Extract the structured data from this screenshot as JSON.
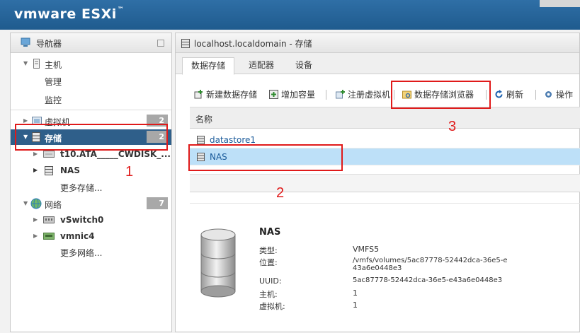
{
  "app": {
    "brand": "vmware",
    "product": "ESXi"
  },
  "navigator": {
    "title": "导航器",
    "items": [
      {
        "label": "主机",
        "level": 0,
        "expanded": true
      },
      {
        "label": "管理",
        "level": 1
      },
      {
        "label": "监控",
        "level": 1
      },
      {
        "label": "虚拟机",
        "level": 0,
        "badge": "2"
      },
      {
        "label": "存储",
        "level": 0,
        "badge": "2",
        "selected": true
      },
      {
        "label": "t10.ATA_____CWDISK_...",
        "level": 1
      },
      {
        "label": "NAS",
        "level": 1
      },
      {
        "label": "更多存储...",
        "level": 1
      },
      {
        "label": "网络",
        "level": 0,
        "badge": "7"
      },
      {
        "label": "vSwitch0",
        "level": 1
      },
      {
        "label": "vmnic4",
        "level": 1
      },
      {
        "label": "更多网络...",
        "level": 1
      }
    ]
  },
  "main": {
    "title": "localhost.localdomain - 存储",
    "tabs": [
      {
        "label": "数据存储",
        "active": true
      },
      {
        "label": "适配器"
      },
      {
        "label": "设备"
      }
    ],
    "toolbar": {
      "new_datastore": "新建数据存储",
      "increase_capacity": "增加容量",
      "register_vm": "注册虚拟机",
      "datastore_browser": "数据存储浏览器",
      "refresh": "刷新",
      "actions": "操作"
    },
    "table": {
      "column_name": "名称",
      "rows": [
        {
          "name": "datastore1",
          "selected": false
        },
        {
          "name": "NAS",
          "selected": true
        }
      ]
    },
    "details": {
      "name": "NAS",
      "fields": [
        {
          "key": "类型:",
          "value": "VMFS5"
        },
        {
          "key": "位置:",
          "value": "/vmfs/volumes/5ac87778-52442dca-36e5-e43a6e0448e3"
        },
        {
          "key": "UUID:",
          "value": "5ac87778-52442dca-36e5-e43a6e0448e3"
        },
        {
          "key": "主机:",
          "value": "1"
        },
        {
          "key": "虚拟机:",
          "value": "1"
        }
      ]
    }
  },
  "annotations": {
    "one": "1",
    "two": "2",
    "three": "3"
  },
  "colors": {
    "topbar": "#2f6fa6",
    "selected_nav": "#2f5f8a",
    "selected_row": "#bde0f8",
    "annotation": "#e01a1a"
  }
}
